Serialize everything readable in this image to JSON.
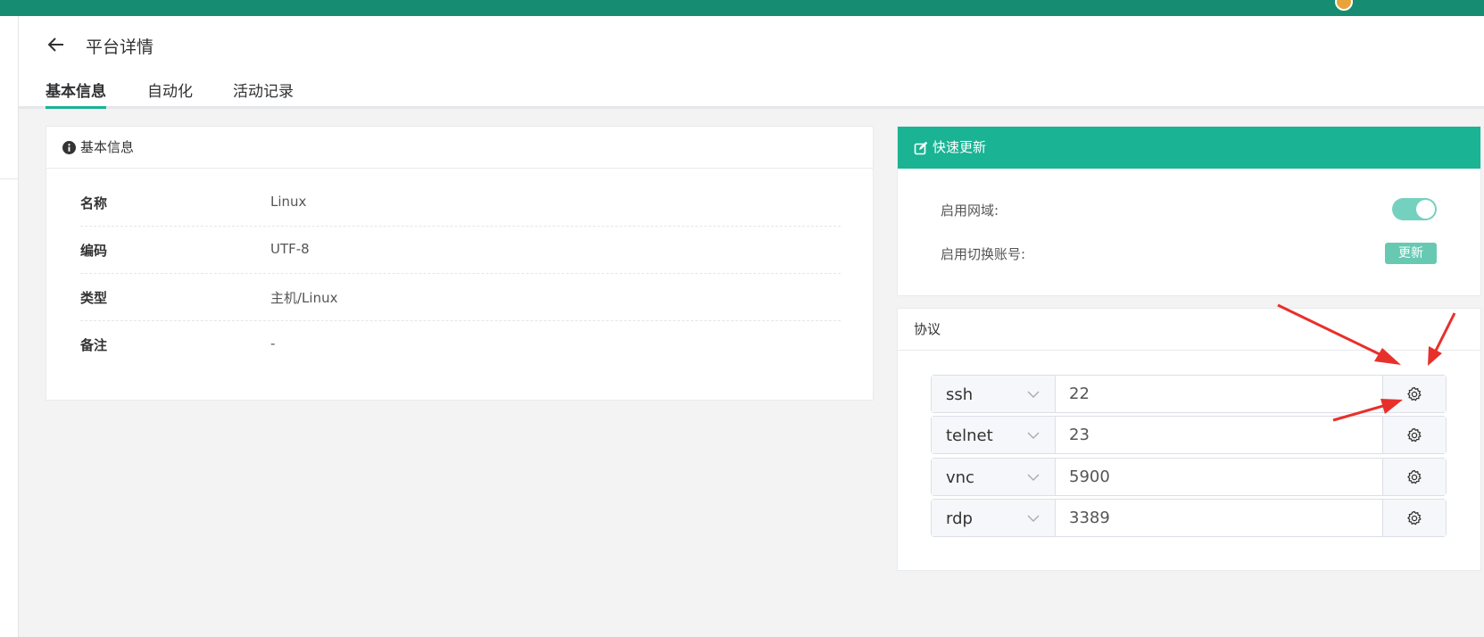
{
  "header": {
    "title": "平台详情",
    "tabs": [
      "基本信息",
      "自动化",
      "活动记录"
    ]
  },
  "basic_info": {
    "title": "基本信息",
    "rows": [
      {
        "label": "名称",
        "value": "Linux"
      },
      {
        "label": "编码",
        "value": "UTF-8"
      },
      {
        "label": "类型",
        "value": "主机/Linux"
      },
      {
        "label": "备注",
        "value": "-"
      }
    ]
  },
  "quick_update": {
    "title": "快速更新",
    "enable_domain_label": "启用网域:",
    "enable_domain_on": true,
    "switch_account_label": "启用切换账号:",
    "update_button": "更新"
  },
  "protocols": {
    "title": "协议",
    "items": [
      {
        "name": "ssh",
        "port": "22"
      },
      {
        "name": "telnet",
        "port": "23"
      },
      {
        "name": "vnc",
        "port": "5900"
      },
      {
        "name": "rdp",
        "port": "3389"
      }
    ]
  },
  "colors": {
    "accent": "#1ab394",
    "topbar": "#168c73",
    "annotation_arrow": "#e8302a"
  }
}
